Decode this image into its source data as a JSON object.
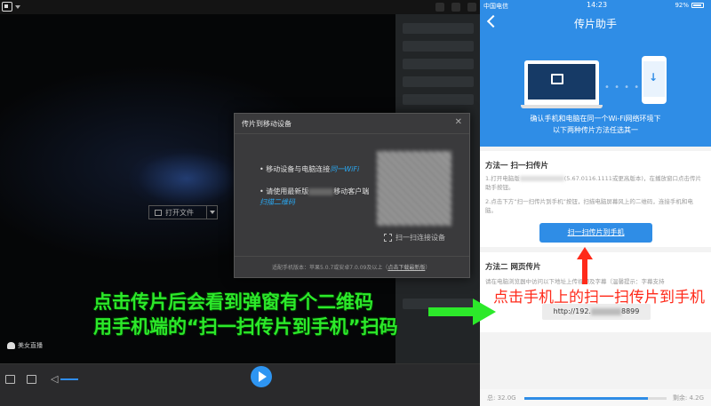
{
  "player": {
    "open_file": "打开文件",
    "live_label": "美女直播"
  },
  "dialog": {
    "title": "传片到移动设备",
    "close": "✕",
    "bullet1": "移动设备与电脑连接",
    "bullet1_highlight": "同一WiFi",
    "bullet2_a": "请使用最新版",
    "bullet2_b": "移动客户端",
    "bullet2_highlight": "扫描二维码",
    "scan_label": "扫一扫连接设备",
    "footer_text": "适配手机版本：苹果5.0.7或安卓7.0.09及以上（",
    "footer_link": "点击下载最新版",
    "footer_end": "）"
  },
  "annotations": {
    "line1": "点击传片后会看到弹窗有个二维码",
    "line2": "用手机端的“扫一扫传片到手机”扫码",
    "red_note": "点击手机上的扫一扫传片到手机"
  },
  "phone": {
    "carrier": "中国电信",
    "time": "14:23",
    "battery": "92%",
    "title": "传片助手",
    "subtitle1": "确认手机和电脑在同一个Wi-Fi网络环境下",
    "subtitle2": "以下两种传片方法任选其一",
    "method1": {
      "title": "方法一 扫一扫传片",
      "step1_a": "1.打开电脑版",
      "step1_b": "(5.67.0116.1111或更高版本)，在播放窗口点击传片助手按钮。",
      "step2": "2.点击下方“扫一扫传片到手机”按钮，扫描电脑屏幕风上的二维码，连接手机和电脑。",
      "button": "扫一扫传片到手机"
    },
    "method2": {
      "title": "方法二 网页传片",
      "text": "请在电脑浏览器中访问以下地址上传视频及字幕（温馨提示：字幕支持",
      "url_prefix": "http://192.",
      "url_suffix": "8899"
    },
    "storage": {
      "used": "总: 32.0G",
      "remaining": "剩余: 4.2G",
      "used_fraction": 0.87
    }
  }
}
